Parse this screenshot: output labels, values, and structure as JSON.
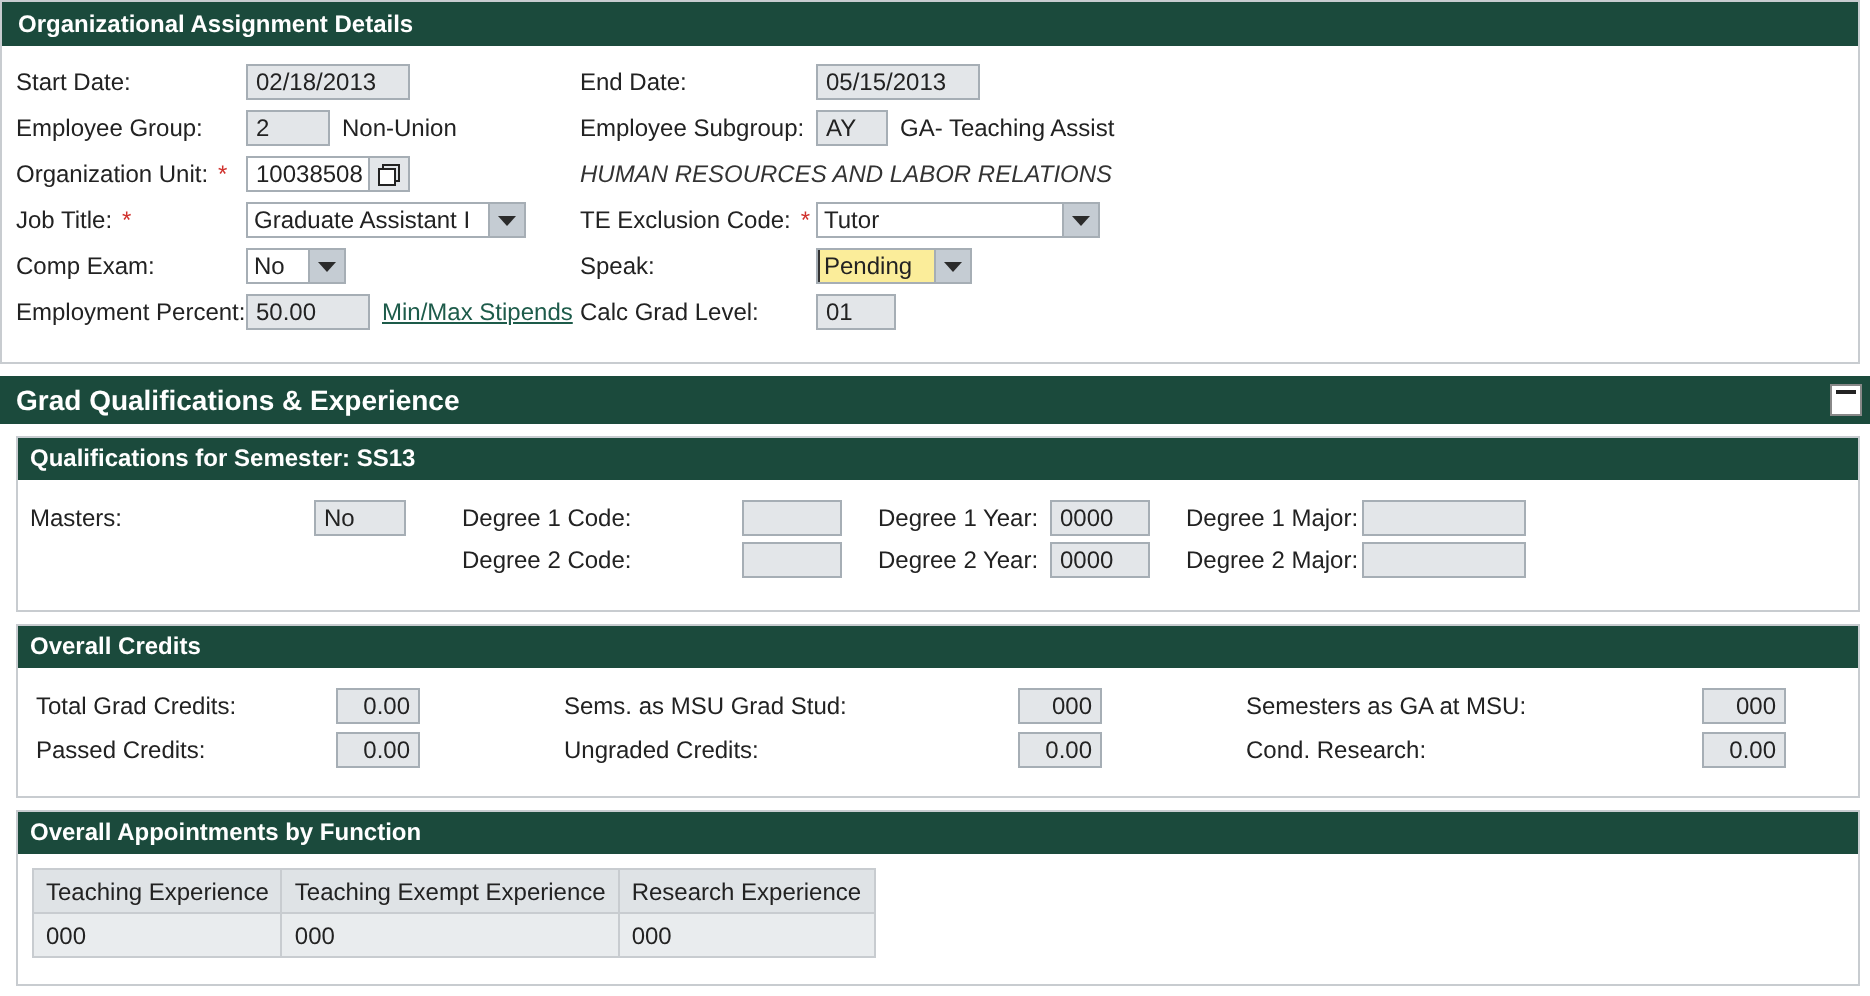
{
  "org": {
    "title": "Organizational Assignment Details",
    "rows": [
      {
        "left": {
          "label": "Start Date:",
          "kind": "readonly",
          "value": "02/18/2013"
        },
        "right": {
          "label": "End Date:",
          "kind": "readonly",
          "value": "05/15/2013"
        }
      },
      {
        "left": {
          "label": "Employee Group:",
          "kind": "readonly",
          "value": "2",
          "extra": "Non-Union"
        },
        "right": {
          "label": "Employee Subgroup:",
          "kind": "readonly",
          "value": "AY",
          "extra": "GA- Teaching Assist"
        }
      },
      {
        "left": {
          "label": "Organization Unit:",
          "required_mark": "*",
          "kind": "lookup",
          "value": "10038508"
        },
        "right": {
          "kind": "note",
          "value": "HUMAN RESOURCES AND LABOR RELATIONS"
        }
      },
      {
        "left": {
          "label": "Job Title:",
          "required_mark": "*",
          "kind": "select",
          "value": "Graduate Assistant I",
          "focused": false
        },
        "right": {
          "label": "TE Exclusion Code:",
          "required_mark": "*",
          "kind": "select",
          "value": "Tutor",
          "focused": false
        }
      },
      {
        "left": {
          "label": "Comp Exam:",
          "kind": "select",
          "value": "No",
          "focused": false
        },
        "right": {
          "label": "Speak:",
          "kind": "select",
          "value": "Pending",
          "focused": true
        }
      },
      {
        "left": {
          "label": "Employment Percent:",
          "kind": "readonly",
          "value": "50.00",
          "link": "Min/Max Stipends"
        },
        "right": {
          "label": "Calc Grad Level:",
          "kind": "readonly",
          "value": "01"
        }
      }
    ]
  },
  "grad": {
    "title": "Grad Qualifications & Experience",
    "expanded": true,
    "qualifications": {
      "title": "Qualifications for Semester: SS13",
      "masters": {
        "label": "Masters:",
        "value": "No"
      },
      "degrees": [
        {
          "code_label": "Degree 1 Code:",
          "year_label": "Degree 1 Year:",
          "year": "0000",
          "major_label": "Degree 1 Major:"
        },
        {
          "code_label": "Degree 2 Code:",
          "year_label": "Degree 2 Year:",
          "year": "0000",
          "major_label": "Degree 2 Major:"
        }
      ]
    },
    "credits": {
      "title": "Overall Credits",
      "rows": [
        [
          {
            "label": "Total Grad Credits:",
            "value": "0.00"
          },
          {
            "label": "Sems. as MSU Grad Stud:",
            "value": "000"
          },
          {
            "label": "Semesters as GA at MSU:",
            "value": "000"
          }
        ],
        [
          {
            "label": "Passed Credits:",
            "value": "0.00"
          },
          {
            "label": "Ungraded Credits:",
            "value": "0.00"
          },
          {
            "label": "Cond. Research:",
            "value": "0.00"
          }
        ]
      ]
    },
    "appointments": {
      "title": "Overall Appointments by Function",
      "columns": [
        "Teaching Experience",
        "Teaching Exempt Experience",
        "Research Experience"
      ],
      "rows": [
        [
          "000",
          "000",
          "000"
        ]
      ]
    }
  }
}
